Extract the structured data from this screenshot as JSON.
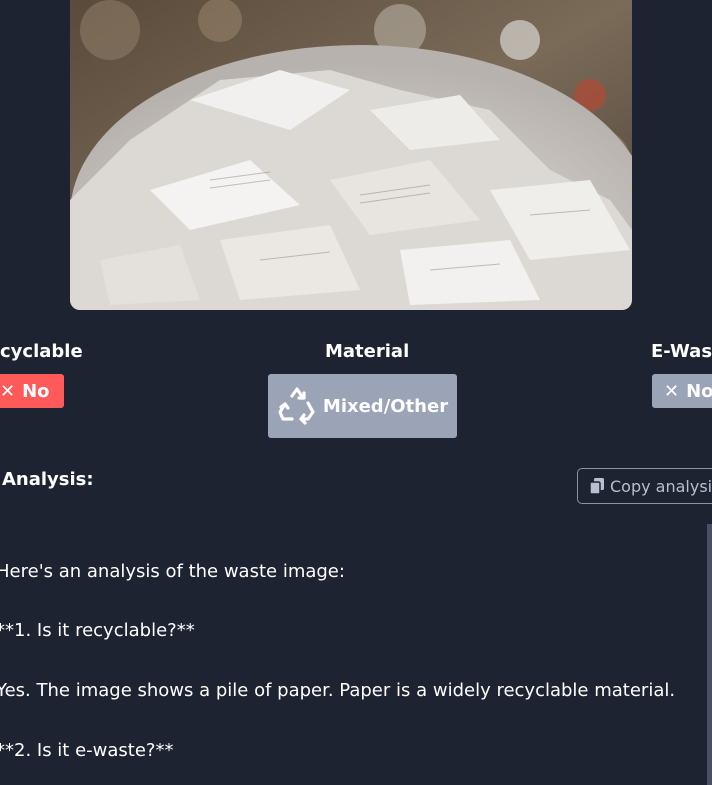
{
  "stats": {
    "recyclable": {
      "label": "cyclable",
      "badge": "No",
      "badge_icon": "x-icon",
      "color": "#ff5a5a"
    },
    "material": {
      "label": "Material",
      "badge": "Mixed/Other",
      "badge_icon": "recycle-icon",
      "color": "#9ba3b6"
    },
    "ewaste": {
      "label": "E-Wast",
      "badge": "No",
      "badge_icon": "x-icon",
      "color": "#9ba3b6"
    }
  },
  "analysis": {
    "heading": "Analysis:",
    "copy_label": "Copy analysis",
    "paragraphs": [
      "Here's an analysis of the waste image:",
      "**1. Is it recyclable?**",
      "Yes. The image shows a pile of paper. Paper is a widely recyclable material.",
      "**2. Is it e-waste?**"
    ]
  }
}
